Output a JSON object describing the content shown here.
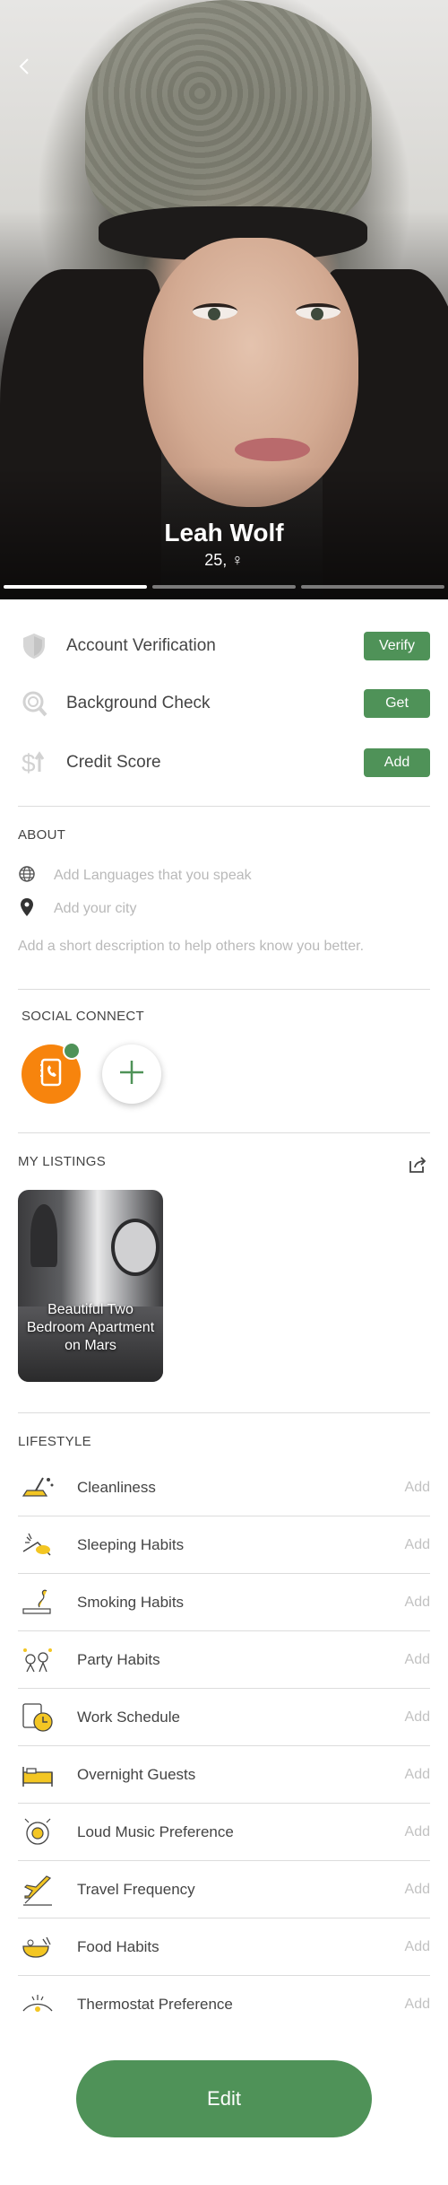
{
  "profile": {
    "name": "Leah Wolf",
    "age_gender": "25, ♀",
    "photo_pages": 3,
    "active_photo": 1
  },
  "verification": {
    "items": [
      {
        "label": "Account Verification",
        "action": "Verify",
        "icon": "shield-icon"
      },
      {
        "label": "Background Check",
        "action": "Get",
        "icon": "fingerprint-icon"
      },
      {
        "label": "Credit Score",
        "action": "Add",
        "icon": "dollar-arrows-icon"
      }
    ]
  },
  "about": {
    "title": "ABOUT",
    "languages_placeholder": "Add Languages that you speak",
    "city_placeholder": "Add your city",
    "description_placeholder": "Add a short description to help others know you better."
  },
  "social": {
    "title": "SOCIAL CONNECT",
    "connected": [
      "contacts-icon"
    ]
  },
  "listings": {
    "title": "MY LISTINGS",
    "items": [
      {
        "title": "Beautiful Two Bedroom Apartment on Mars"
      }
    ]
  },
  "lifestyle": {
    "title": "LIFESTYLE",
    "add_label": "Add",
    "items": [
      {
        "label": "Cleanliness",
        "icon": "cleaning-icon"
      },
      {
        "label": "Sleeping Habits",
        "icon": "sleep-icon"
      },
      {
        "label": "Smoking Habits",
        "icon": "smoking-icon"
      },
      {
        "label": "Party Habits",
        "icon": "party-icon"
      },
      {
        "label": "Work Schedule",
        "icon": "work-clock-icon"
      },
      {
        "label": "Overnight Guests",
        "icon": "bed-icon"
      },
      {
        "label": "Loud Music Preference",
        "icon": "speaker-icon"
      },
      {
        "label": "Travel Frequency",
        "icon": "plane-icon"
      },
      {
        "label": "Food Habits",
        "icon": "food-icon"
      },
      {
        "label": "Thermostat Preference",
        "icon": "thermostat-icon"
      }
    ]
  },
  "actions": {
    "edit_label": "Edit"
  },
  "colors": {
    "accent_green": "#4f9258",
    "social_orange": "#f7840d",
    "placeholder_gray": "#b9b9b9"
  }
}
